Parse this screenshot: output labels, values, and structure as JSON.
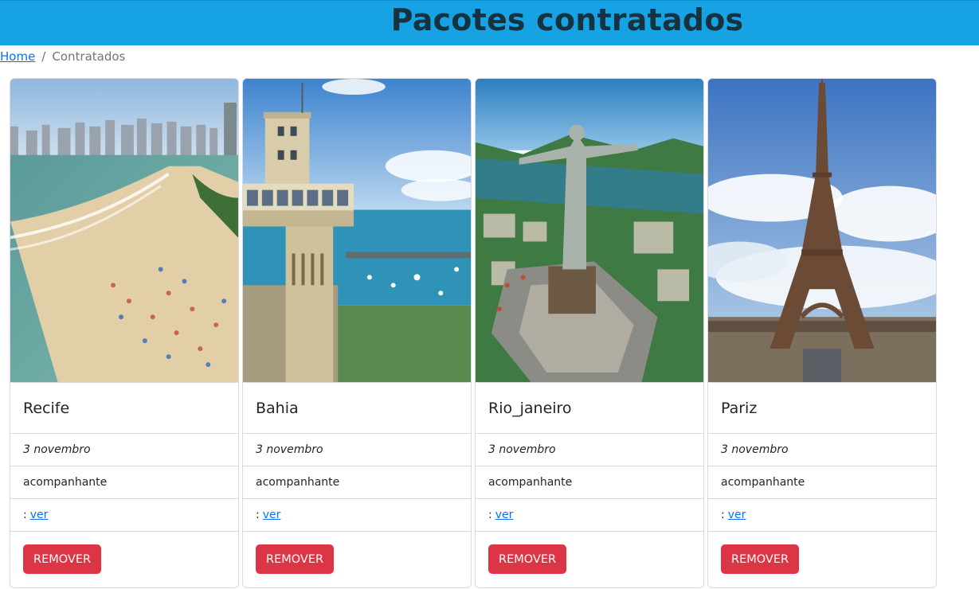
{
  "header": {
    "title": "Pacotes contratados"
  },
  "breadcrumb": {
    "home": "Home",
    "separator": "/",
    "current": "Contratados"
  },
  "cards": [
    {
      "title": "Recife",
      "date": "3 novembro",
      "companion": "acompanhante",
      "link_prefix": ":",
      "link_label": "ver",
      "button": "REMOVER",
      "image": "recife-beach-photo"
    },
    {
      "title": "Bahia",
      "date": "3 novembro",
      "companion": "acompanhante",
      "link_prefix": ":",
      "link_label": "ver",
      "button": "REMOVER",
      "image": "salvador-elevator-photo"
    },
    {
      "title": "Rio_janeiro",
      "date": "3 novembro",
      "companion": "acompanhante",
      "link_prefix": ":",
      "link_label": "ver",
      "button": "REMOVER",
      "image": "christ-redeemer-photo"
    },
    {
      "title": "Pariz",
      "date": "3 novembro",
      "companion": "acompanhante",
      "link_prefix": ":",
      "link_label": "ver",
      "button": "REMOVER",
      "image": "eiffel-tower-photo"
    }
  ],
  "colors": {
    "header_bg": "#17a2e3",
    "remove_button": "#dc3545",
    "link": "#0d6efd"
  }
}
